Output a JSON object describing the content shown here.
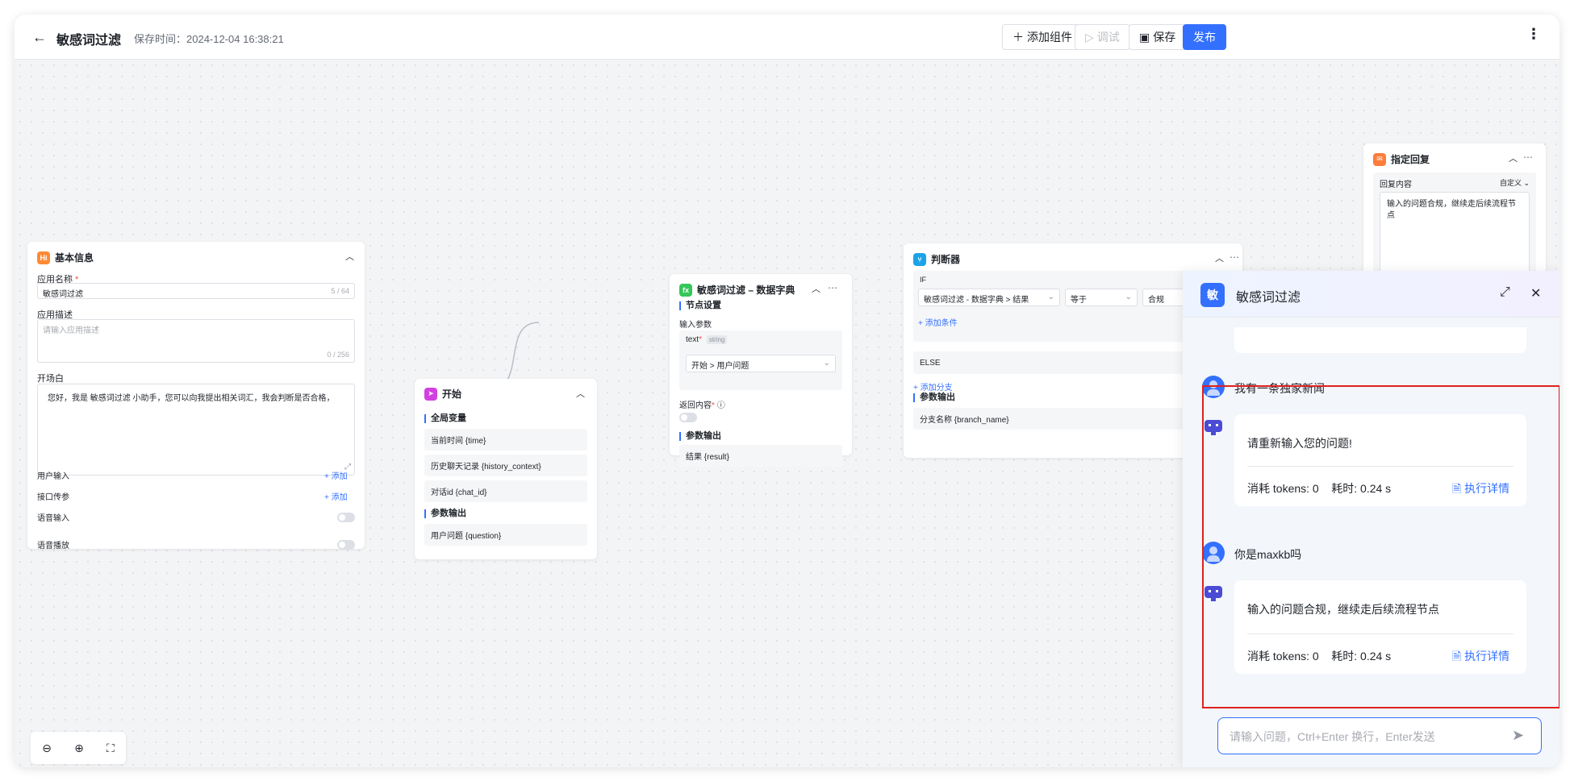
{
  "header": {
    "back_icon": "arrow-left-icon",
    "title": "敏感词过滤",
    "save_time": "保存时间：2024-12-04 16:38:21",
    "add_component": "添加组件",
    "debug": "调试",
    "save": "保存",
    "publish": "发布",
    "more_icon": "more-vertical-icon"
  },
  "basic_info": {
    "title": "基本信息",
    "app_name_label": "应用名称",
    "app_name_value": "敏感词过滤",
    "app_name_count": "5 / 64",
    "app_desc_label": "应用描述",
    "app_desc_placeholder": "请输入应用描述",
    "app_desc_count": "0 / 256",
    "opening_label": "开场白",
    "opening_value": "您好，我是 敏感词过滤 小助手，您可以向我提出相关词汇，我会判断是否合格，",
    "user_input_label": "用户输入",
    "api_param_label": "接口传参",
    "add_label": "+ 添加",
    "voice_input_label": "语音输入",
    "voice_play_label": "语音播放"
  },
  "start_node": {
    "title": "开始",
    "global_vars": "全局变量",
    "vars": [
      "当前时间 {time}",
      "历史聊天记录 {history_context}",
      "对话id {chat_id}"
    ],
    "output_title": "参数输出",
    "output": "用户问题 {question}"
  },
  "dict_node": {
    "title": "敏感词过滤 – 数据字典",
    "node_settings": "节点设置",
    "input_params": "输入参数",
    "param_name": "text",
    "param_type": "string",
    "param_value": "开始 > 用户问题",
    "return_content": "返回内容",
    "output_title": "参数输出",
    "output": "结果 {result}"
  },
  "judge_node": {
    "title": "判断器",
    "if_label": "IF",
    "cond_field": "敏感词过滤 - 数据字典 > 结果",
    "cond_op": "等于",
    "cond_value": "合规",
    "add_condition": "+ 添加条件",
    "else_label": "ELSE",
    "add_branch": "+ 添加分支",
    "output_title": "参数输出",
    "output": "分支名称 {branch_name}"
  },
  "reply_node": {
    "title": "指定回复",
    "content_label": "回复内容",
    "mode": "自定义",
    "content": "输入的问题合规，继续走后续流程节点"
  },
  "chat": {
    "logo_text": "敏",
    "title": "敏感词过滤",
    "messages": [
      {
        "user": "我有一条独家新闻",
        "bot": "请重新输入您的问题!",
        "meta": "消耗 tokens: 0    耗时: 0.24 s",
        "exec": "执行详情"
      },
      {
        "user": "你是maxkb吗",
        "bot": "输入的问题合规，继续走后续流程节点",
        "meta": "消耗 tokens: 0    耗时: 0.24 s",
        "exec": "执行详情"
      }
    ],
    "input_placeholder": "请输入问题，Ctrl+Enter 换行，Enter发送"
  }
}
